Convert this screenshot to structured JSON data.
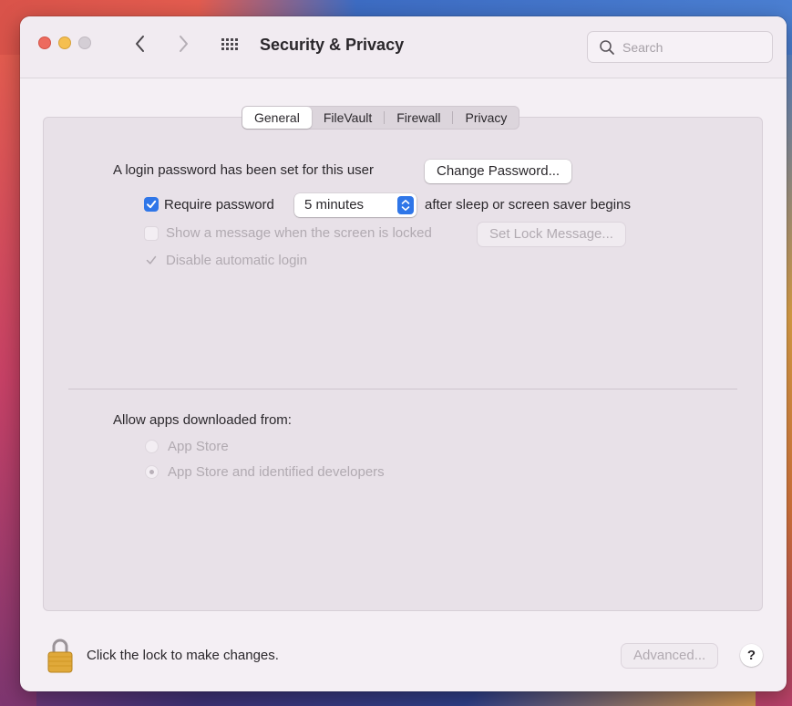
{
  "window": {
    "title": "Security & Privacy",
    "search_placeholder": "Search"
  },
  "tabs": [
    {
      "label": "General",
      "active": true
    },
    {
      "label": "FileVault",
      "active": false
    },
    {
      "label": "Firewall",
      "active": false
    },
    {
      "label": "Privacy",
      "active": false
    }
  ],
  "general": {
    "login_password_text": "A login password has been set for this user",
    "change_password_label": "Change Password...",
    "require_password_label": "Require password",
    "require_password_checked": true,
    "require_password_delay": "5 minutes",
    "after_sleep_text": "after sleep or screen saver begins",
    "show_message_label": "Show a message when the screen is locked",
    "show_message_checked": false,
    "set_lock_message_label": "Set Lock Message...",
    "disable_auto_login_label": "Disable automatic login",
    "disable_auto_login_checked": true
  },
  "allow_apps": {
    "heading": "Allow apps downloaded from:",
    "options": [
      {
        "label": "App Store",
        "selected": false
      },
      {
        "label": "App Store and identified developers",
        "selected": true
      }
    ]
  },
  "footer": {
    "lock_text": "Click the lock to make changes.",
    "advanced_label": "Advanced...",
    "help_label": "?"
  },
  "colors": {
    "accent": "#2f76e8",
    "window_bg": "#f4eff4",
    "panel_bg": "#e8e1e8"
  }
}
